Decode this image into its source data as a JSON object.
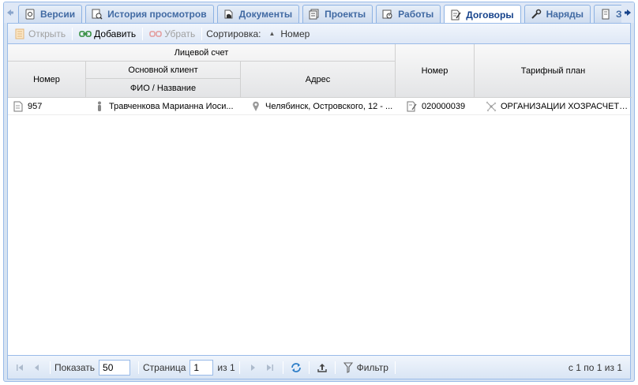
{
  "tabs": [
    {
      "label": "Версии",
      "icon": "version-icon",
      "active": false
    },
    {
      "label": "История просмотров",
      "icon": "history-icon",
      "active": false
    },
    {
      "label": "Документы",
      "icon": "documents-icon",
      "active": false
    },
    {
      "label": "Проекты",
      "icon": "projects-icon",
      "active": false
    },
    {
      "label": "Работы",
      "icon": "works-icon",
      "active": false
    },
    {
      "label": "Договоры",
      "icon": "contracts-icon",
      "active": true
    },
    {
      "label": "Наряды",
      "icon": "orders-icon",
      "active": false
    },
    {
      "label": "З",
      "icon": "more-icon",
      "active": false
    }
  ],
  "toolbar": {
    "open_label": "Открыть",
    "add_label": "Добавить",
    "remove_label": "Убрать",
    "sort_label": "Сортировка:",
    "sort_field": "Номер"
  },
  "columns": {
    "account_group": "Лицевой счет",
    "client_group": "Основной клиент",
    "number": "Номер",
    "name": "ФИО / Название",
    "address": "Адрес",
    "contract_number": "Номер",
    "tariff": "Тарифный план"
  },
  "rows": [
    {
      "account_number": "957",
      "client_name": "Травченкова Марианна Иоси...",
      "address": "Челябинск, Островского, 12 - ...",
      "contract_number": "020000039",
      "tariff": "ОРГАНИЗАЦИИ ХОЗРАСЧЕТНЫЕ"
    }
  ],
  "pager": {
    "show_label": "Показать",
    "page_size": "50",
    "page_label": "Страница",
    "page_value": "1",
    "of_label": "из 1",
    "filter_label": "Фильтр",
    "info": "с 1 по 1 из 1"
  },
  "colors": {
    "frame_border": "#99bbe8",
    "tab_text": "#15428b",
    "header_bg": "#e3e4e6"
  }
}
